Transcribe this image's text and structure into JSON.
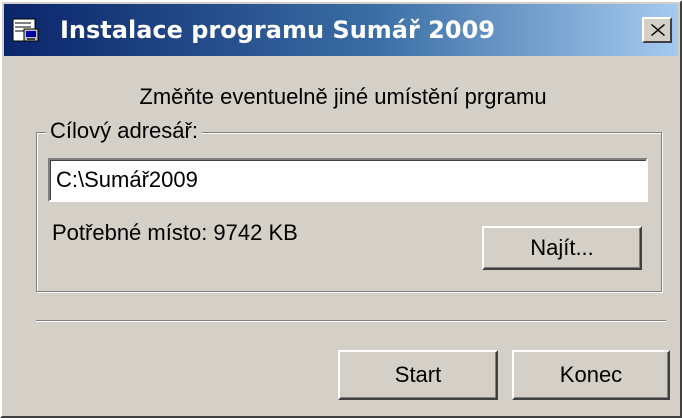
{
  "window": {
    "title": "Instalace  programu Sumář  2009",
    "title_icon": "setup-icon",
    "close_icon": "close-icon",
    "colors": {
      "titlebar_start": "#0a246a",
      "titlebar_end": "#a6caf0",
      "face": "#d4d0c8"
    }
  },
  "dialog": {
    "subtitle": "Změňte eventuelně jiné umístění prgramu",
    "group_label": "Cílový adresář:",
    "path_value": "C:\\Sumář2009",
    "space_label": "Potřebné místo: 9742 KB",
    "find_button": "Najít...",
    "start_button": "Start",
    "end_button": "Konec"
  }
}
